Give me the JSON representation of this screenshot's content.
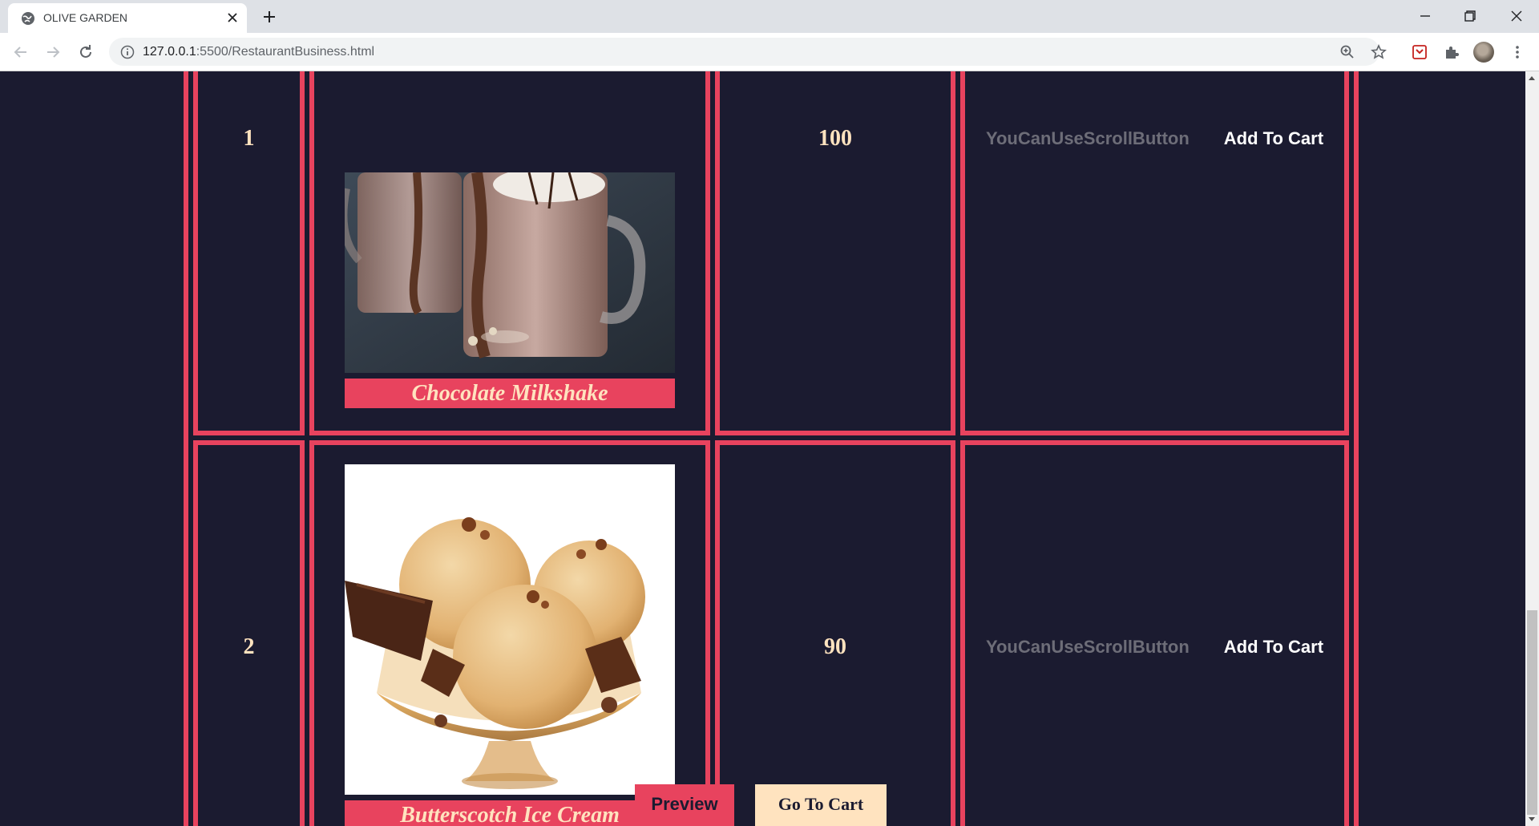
{
  "browser": {
    "tab_title": "OLIVE GARDEN",
    "url_host": "127.0.0.1",
    "url_rest": ":5500/RestaurantBusiness.html"
  },
  "menu": {
    "rows": [
      {
        "number": "1",
        "item_name": "Chocolate Milkshake",
        "price": "100",
        "scroll_hint": "YouCanUseScrollButton",
        "add_label": "Add To Cart",
        "image": "chocolate-milkshake-photo"
      },
      {
        "number": "2",
        "item_name": "Butterscotch Ice Cream",
        "price": "90",
        "scroll_hint": "YouCanUseScrollButton",
        "add_label": "Add To Cart",
        "image": "butterscotch-ice-cream-photo"
      }
    ]
  },
  "buttons": {
    "preview": "Preview",
    "go_to_cart": "Go To Cart"
  },
  "colors": {
    "background": "#1b1b30",
    "accent": "#e8435e",
    "cream": "#ffe3bf"
  }
}
